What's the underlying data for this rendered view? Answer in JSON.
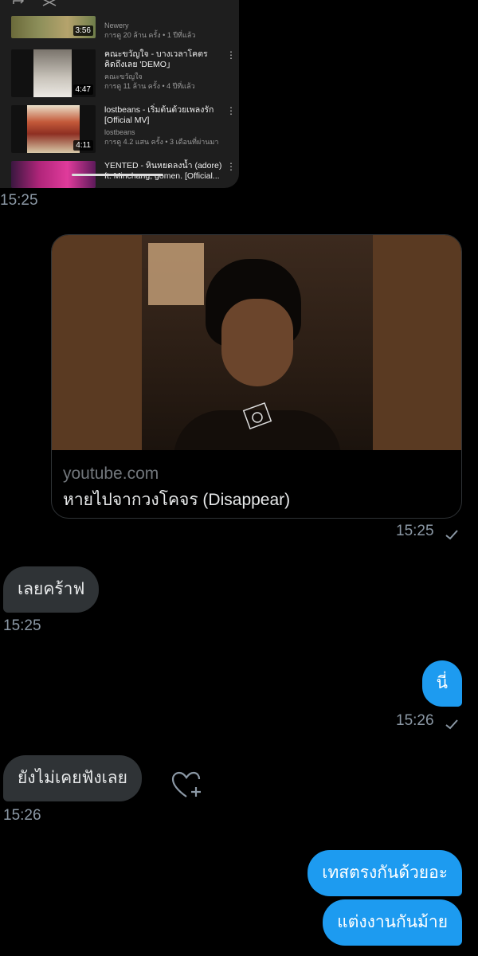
{
  "youtube_card": {
    "videos": [
      {
        "title": "",
        "channel": "Newery",
        "stats": "การดู 20 ล้าน ครั้ง • 1 ปีที่แล้ว",
        "duration": "3:56"
      },
      {
        "title": "คณะขวัญใจ - บางเวลาโคตรคิดถึงเลย 'DEMO」",
        "channel": "คณะขวัญใจ",
        "stats": "การดู 11 ล้าน ครั้ง • 4 ปีที่แล้ว",
        "duration": "4:47"
      },
      {
        "title": "lostbeans - เริ่มต้นด้วยเพลงรัก [Official MV]",
        "channel": "lostbeans",
        "stats": "การดู 4.2 แสน ครั้ง • 3 เดือนที่ผ่านมา",
        "duration": "4:11"
      },
      {
        "title": "YENTED - หินหยดลงน้ำ (adore) ft. Minchang, gomen. [Official...",
        "channel": "",
        "stats": "",
        "duration": ""
      }
    ],
    "timestamp": "15:25"
  },
  "link_card": {
    "domain": "youtube.com",
    "title": "หายไปจากวงโคจร (Disappear)",
    "timestamp": "15:25"
  },
  "messages": [
    {
      "text": "เลยคร้าฟ",
      "timestamp": "15:25"
    },
    {
      "text": "นี่",
      "timestamp": "15:26"
    },
    {
      "text": "ยังไม่เคยฟังเลย",
      "timestamp": "15:26"
    },
    {
      "text": "เทสตรงกันด้วยอะ"
    },
    {
      "text": "แต่งงานกันม้าย"
    }
  ],
  "colors": {
    "accent": "#1d9bf0",
    "incoming_bubble": "#2f3336",
    "timestamp": "#8b98a5"
  }
}
